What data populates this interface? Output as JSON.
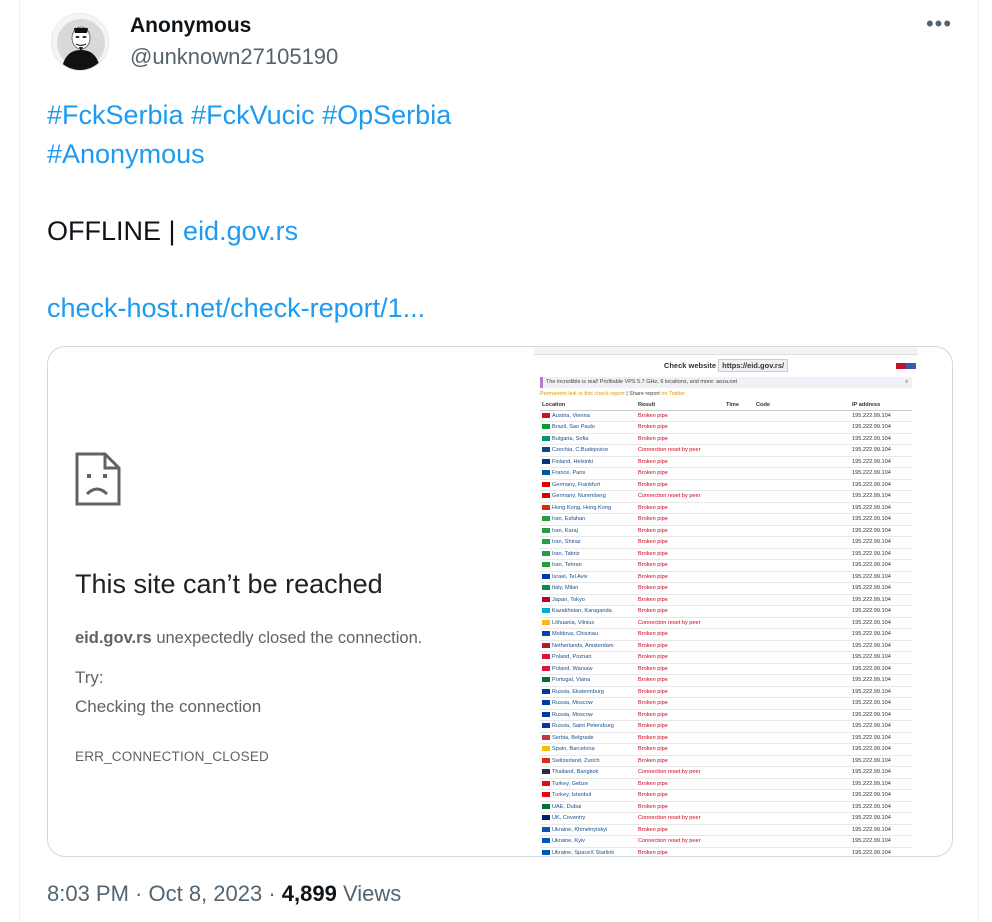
{
  "author": {
    "name": "Anonymous",
    "handle": "@unknown27105190",
    "avatar_icon": "anonymous-mask-icon"
  },
  "more_icon": "more-options-icon",
  "tweet": {
    "hashtags_line1": [
      "#FckSerbia",
      "#FckVucic",
      "#OpSerbia"
    ],
    "hashtags_line2": "#Anonymous",
    "status_prefix": "OFFLINE |",
    "status_link": "eid.gov.rs",
    "report_link": "check-host.net/check-report/1..."
  },
  "error_page": {
    "icon": "sad-page-icon",
    "title": "This site can’t be reached",
    "domain": "eid.gov.rs",
    "description": "unexpectedly closed the connection.",
    "try_label": "Try:",
    "suggestion": "Checking the connection",
    "error_code": "ERR_CONNECTION_CLOSED"
  },
  "report": {
    "heading": "Check website",
    "url": "https://eid.gov.rs/",
    "ad_text": "The incredible is real! Profitable VPS 5.7 GHz, 6 locations, and more: aeza.net",
    "ad_close": "x",
    "permalink_text": "Permanent link to this check report",
    "share_text": "| Share report",
    "twitter_text": "on Twitter",
    "columns": [
      "Location",
      "Result",
      "Time",
      "Code",
      "IP address"
    ],
    "rows": [
      {
        "loc": "Austria, Vienna",
        "res": "Broken pipe",
        "ip": "195.222.99.104",
        "flag": "#c8102e"
      },
      {
        "loc": "Brazil, Sao Paulo",
        "res": "Broken pipe",
        "ip": "195.222.99.104",
        "flag": "#009c3b"
      },
      {
        "loc": "Bulgaria, Sofia",
        "res": "Broken pipe",
        "ip": "195.222.99.104",
        "flag": "#00966e"
      },
      {
        "loc": "Czechia, C.Budejovice",
        "res": "Connection reset by peer",
        "ip": "195.222.99.104",
        "flag": "#11457e"
      },
      {
        "loc": "Finland, Helsinki",
        "res": "Broken pipe",
        "ip": "195.222.99.104",
        "flag": "#003580"
      },
      {
        "loc": "France, Paris",
        "res": "Broken pipe",
        "ip": "195.222.99.104",
        "flag": "#0055a4"
      },
      {
        "loc": "Germany, Frankfurt",
        "res": "Broken pipe",
        "ip": "195.222.99.104",
        "flag": "#dd0000"
      },
      {
        "loc": "Germany, Nuremberg",
        "res": "Connection reset by peer",
        "ip": "195.222.99.104",
        "flag": "#dd0000"
      },
      {
        "loc": "Hong Kong, Hong Kong",
        "res": "Broken pipe",
        "ip": "195.222.99.104",
        "flag": "#de2910"
      },
      {
        "loc": "Iran, Esfahan",
        "res": "Broken pipe",
        "ip": "195.222.99.104",
        "flag": "#239f40"
      },
      {
        "loc": "Iran, Karaj",
        "res": "Broken pipe",
        "ip": "195.222.99.104",
        "flag": "#239f40"
      },
      {
        "loc": "Iran, Shiraz",
        "res": "Broken pipe",
        "ip": "195.222.99.104",
        "flag": "#239f40"
      },
      {
        "loc": "Iran, Tabriz",
        "res": "Broken pipe",
        "ip": "195.222.99.104",
        "flag": "#239f40"
      },
      {
        "loc": "Iran, Tehran",
        "res": "Broken pipe",
        "ip": "195.222.99.104",
        "flag": "#239f40"
      },
      {
        "loc": "Israel, Tel Aviv",
        "res": "Broken pipe",
        "ip": "195.222.99.104",
        "flag": "#0038b8"
      },
      {
        "loc": "Italy, Milan",
        "res": "Broken pipe",
        "ip": "195.222.99.104",
        "flag": "#009246"
      },
      {
        "loc": "Japan, Tokyo",
        "res": "Broken pipe",
        "ip": "195.222.99.104",
        "flag": "#bc002d"
      },
      {
        "loc": "Kazakhstan, Karaganda",
        "res": "Broken pipe",
        "ip": "195.222.99.104",
        "flag": "#00afca"
      },
      {
        "loc": "Lithuania, Vilnius",
        "res": "Connection reset by peer",
        "ip": "195.222.99.104",
        "flag": "#fdb913"
      },
      {
        "loc": "Moldova, Chisinau",
        "res": "Broken pipe",
        "ip": "195.222.99.104",
        "flag": "#0046ae"
      },
      {
        "loc": "Netherlands, Amsterdam",
        "res": "Broken pipe",
        "ip": "195.222.99.104",
        "flag": "#ae1c28"
      },
      {
        "loc": "Poland, Poznan",
        "res": "Broken pipe",
        "ip": "195.222.99.104",
        "flag": "#dc143c"
      },
      {
        "loc": "Poland, Warsaw",
        "res": "Broken pipe",
        "ip": "195.222.99.104",
        "flag": "#dc143c"
      },
      {
        "loc": "Portugal, Viana",
        "res": "Broken pipe",
        "ip": "195.222.99.104",
        "flag": "#046a38"
      },
      {
        "loc": "Russia, Ekaterinburg",
        "res": "Broken pipe",
        "ip": "195.222.99.104",
        "flag": "#0039a6"
      },
      {
        "loc": "Russia, Moscow",
        "res": "Broken pipe",
        "ip": "195.222.99.104",
        "flag": "#0039a6"
      },
      {
        "loc": "Russia, Moscow",
        "res": "Broken pipe",
        "ip": "195.222.99.104",
        "flag": "#0039a6"
      },
      {
        "loc": "Russia, Saint Petersburg",
        "res": "Broken pipe",
        "ip": "195.222.99.104",
        "flag": "#0039a6"
      },
      {
        "loc": "Serbia, Belgrade",
        "res": "Broken pipe",
        "ip": "195.222.99.104",
        "flag": "#c6363c"
      },
      {
        "loc": "Spain, Barcelona",
        "res": "Broken pipe",
        "ip": "195.222.99.104",
        "flag": "#f1bf00"
      },
      {
        "loc": "Switzerland, Zurich",
        "res": "Broken pipe",
        "ip": "195.222.99.104",
        "flag": "#d52b1e"
      },
      {
        "loc": "Thailand, Bangkok",
        "res": "Connection reset by peer",
        "ip": "195.222.99.104",
        "flag": "#2d2a4a"
      },
      {
        "loc": "Turkey, Gebze",
        "res": "Broken pipe",
        "ip": "195.222.99.104",
        "flag": "#e30a17"
      },
      {
        "loc": "Turkey, Istanbul",
        "res": "Broken pipe",
        "ip": "195.222.99.104",
        "flag": "#e30a17"
      },
      {
        "loc": "UAE, Dubai",
        "res": "Broken pipe",
        "ip": "195.222.99.104",
        "flag": "#00732f"
      },
      {
        "loc": "UK, Coventry",
        "res": "Connection reset by peer",
        "ip": "195.222.99.104",
        "flag": "#012169"
      },
      {
        "loc": "Ukraine, Khmelnytskyi",
        "res": "Broken pipe",
        "ip": "195.222.99.104",
        "flag": "#0057b7"
      },
      {
        "loc": "Ukraine, Kyiv",
        "res": "Connection reset by peer",
        "ip": "195.222.99.104",
        "flag": "#0057b7"
      },
      {
        "loc": "Ukraine, SpaceX Starlink",
        "res": "Broken pipe",
        "ip": "195.222.99.104",
        "flag": "#0057b7"
      }
    ]
  },
  "footer": {
    "time": "8:03 PM · Oct 8, 2023 ·",
    "views_count": "4,899",
    "views_label": "Views"
  },
  "colors": {
    "link": "#1d9bf0",
    "secondary_text": "#536471",
    "error_red": "#d0021b"
  }
}
